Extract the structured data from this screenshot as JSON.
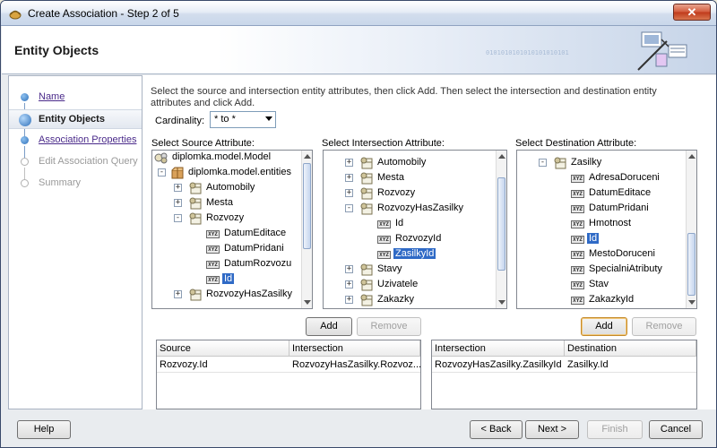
{
  "window": {
    "title": "Create Association - Step 2 of 5"
  },
  "header": {
    "title": "Entity Objects",
    "binary_pattern": "0101010101010101010101"
  },
  "steps": [
    {
      "label": "Name",
      "state": "link"
    },
    {
      "label": "Entity Objects",
      "state": "current"
    },
    {
      "label": "Association Properties",
      "state": "link"
    },
    {
      "label": "Edit Association Query",
      "state": "disabled"
    },
    {
      "label": "Summary",
      "state": "disabled"
    }
  ],
  "instructions": "Select the source and intersection entity attributes, then click Add.  Then select the intersection and destination entity attributes and click Add.",
  "cardinality": {
    "label": "Cardinality:",
    "value": "* to *"
  },
  "source": {
    "label": "Select Source Attribute:",
    "nodes": [
      {
        "text": "diplomka.model.Model",
        "icon": "model"
      },
      {
        "text": "diplomka.model.entities",
        "icon": "package"
      },
      {
        "text": "Automobily",
        "icon": "entity"
      },
      {
        "text": "Mesta",
        "icon": "entity"
      },
      {
        "text": "Rozvozy",
        "icon": "entity"
      },
      {
        "text": "DatumEditace",
        "icon": "attr"
      },
      {
        "text": "DatumPridani",
        "icon": "attr"
      },
      {
        "text": "DatumRozvozu",
        "icon": "attr"
      },
      {
        "text": "Id",
        "icon": "attr"
      },
      {
        "text": "RozvozyHasZasilky",
        "icon": "entity"
      }
    ]
  },
  "intersection": {
    "label": "Select Intersection Attribute:",
    "nodes": [
      {
        "text": "Automobily",
        "icon": "entity"
      },
      {
        "text": "Mesta",
        "icon": "entity"
      },
      {
        "text": "Rozvozy",
        "icon": "entity"
      },
      {
        "text": "RozvozyHasZasilky",
        "icon": "entity"
      },
      {
        "text": "Id",
        "icon": "attr"
      },
      {
        "text": "RozvozyId",
        "icon": "attr"
      },
      {
        "text": "ZasilkyId",
        "icon": "attr"
      },
      {
        "text": "Stavy",
        "icon": "entity"
      },
      {
        "text": "Uzivatele",
        "icon": "entity"
      },
      {
        "text": "Zakazky",
        "icon": "entity"
      }
    ]
  },
  "destination": {
    "label": "Select Destination Attribute:",
    "nodes": [
      {
        "text": "Zasilky",
        "icon": "entity"
      },
      {
        "text": "AdresaDoruceni",
        "icon": "attr"
      },
      {
        "text": "DatumEditace",
        "icon": "attr"
      },
      {
        "text": "DatumPridani",
        "icon": "attr"
      },
      {
        "text": "Hmotnost",
        "icon": "attr"
      },
      {
        "text": "Id",
        "icon": "attr"
      },
      {
        "text": "MestoDoruceni",
        "icon": "attr"
      },
      {
        "text": "SpecialniAtributy",
        "icon": "attr"
      },
      {
        "text": "Stav",
        "icon": "attr"
      },
      {
        "text": "ZakazkyId",
        "icon": "attr"
      }
    ]
  },
  "buttons": {
    "add_left": "Add",
    "remove_left": "Remove",
    "add_right": "Add",
    "remove_right": "Remove",
    "help": "Help",
    "back": "< Back",
    "next": "Next >",
    "finish": "Finish",
    "cancel": "Cancel"
  },
  "left_table": {
    "headers": [
      "Source",
      "Intersection"
    ],
    "rows": [
      [
        "Rozvozy.Id",
        "RozvozyHasZasilky.Rozvoz..."
      ]
    ]
  },
  "right_table": {
    "headers": [
      "Intersection",
      "Destination"
    ],
    "rows": [
      [
        "RozvozyHasZasilky.ZasilkyId",
        "Zasilky.Id"
      ]
    ]
  },
  "attr_icon_text": "XYZ"
}
